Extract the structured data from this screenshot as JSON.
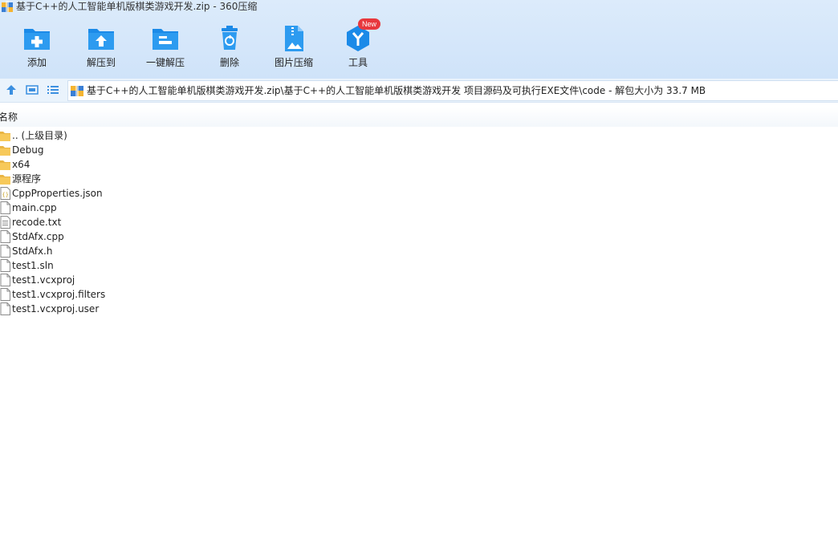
{
  "window": {
    "title": "基于C++的人工智能单机版棋类游戏开发.zip - 360压缩"
  },
  "toolbar": {
    "buttons": [
      {
        "label": "添加",
        "icon": "add-folder-icon"
      },
      {
        "label": "解压到",
        "icon": "extract-to-icon"
      },
      {
        "label": "一键解压",
        "icon": "one-click-extract-icon"
      },
      {
        "label": "删除",
        "icon": "trash-icon"
      },
      {
        "label": "图片压缩",
        "icon": "image-compress-icon"
      },
      {
        "label": "工具",
        "icon": "tools-icon",
        "badge": "New"
      }
    ]
  },
  "navbar": {
    "path": "基于C++的人工智能单机版棋类游戏开发.zip\\基于C++的人工智能单机版棋类游戏开发 项目源码及可执行EXE文件\\code - 解包大小为 33.7 MB"
  },
  "list": {
    "column_name": "名称",
    "items": [
      {
        "name": ".. (上级目录)",
        "type": "folder"
      },
      {
        "name": "Debug",
        "type": "folder"
      },
      {
        "name": "x64",
        "type": "folder"
      },
      {
        "name": "源程序",
        "type": "folder"
      },
      {
        "name": "CppProperties.json",
        "type": "json"
      },
      {
        "name": "main.cpp",
        "type": "file"
      },
      {
        "name": "recode.txt",
        "type": "text"
      },
      {
        "name": "StdAfx.cpp",
        "type": "file"
      },
      {
        "name": "StdAfx.h",
        "type": "file"
      },
      {
        "name": "test1.sln",
        "type": "file"
      },
      {
        "name": "test1.vcxproj",
        "type": "file"
      },
      {
        "name": "test1.vcxproj.filters",
        "type": "file"
      },
      {
        "name": "test1.vcxproj.user",
        "type": "file"
      }
    ]
  },
  "colors": {
    "accent": "#1b8ae8",
    "header_bg": "#d6e8fa",
    "folder": "#f7c95a",
    "badge": "#e8383d"
  }
}
